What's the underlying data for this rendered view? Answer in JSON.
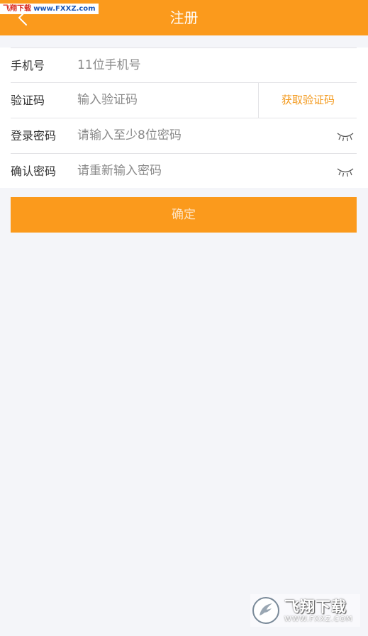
{
  "watermark": {
    "top_name": "飞翔下载",
    "top_url": "www.FXXZ.com",
    "brand": "飞翔下载",
    "url": "WWW.FXXZ.COM"
  },
  "header": {
    "title": "注册",
    "background": "#fb9a1c"
  },
  "form": {
    "phone": {
      "label": "手机号",
      "placeholder": "11位手机号"
    },
    "code": {
      "label": "验证码",
      "placeholder": "输入验证码",
      "button": "获取验证码"
    },
    "password": {
      "label": "登录密码",
      "placeholder": "请输入至少8位密码",
      "toggle_icon": "eye-closed-icon"
    },
    "confirm": {
      "label": "确认密码",
      "placeholder": "请重新输入密码",
      "toggle_icon": "eye-closed-icon"
    }
  },
  "submit": {
    "label": "确定"
  },
  "colors": {
    "accent": "#fb9a1c",
    "link": "#f39a1e",
    "page_bg": "#f4f5f9"
  }
}
